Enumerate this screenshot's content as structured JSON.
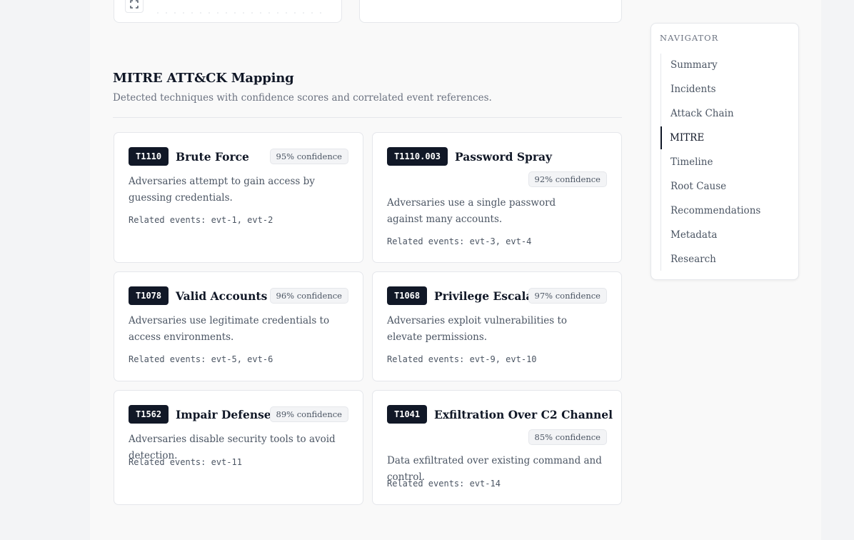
{
  "section": {
    "title": "MITRE ATT&CK Mapping",
    "description": "Detected techniques with confidence scores and correlated event references."
  },
  "techniques": [
    {
      "id": "T1110",
      "name": "Brute Force",
      "confidence": "95% confidence",
      "description": "Adversaries attempt to gain access by guessing credentials.",
      "related": "Related events: evt-1, evt-2"
    },
    {
      "id": "T1110.003",
      "name": "Password Spray",
      "confidence": "92% confidence",
      "description": "Adversaries use a single password against many accounts.",
      "related": "Related events: evt-3, evt-4"
    },
    {
      "id": "T1078",
      "name": "Valid Accounts",
      "confidence": "96% confidence",
      "description": "Adversaries use legitimate credentials to access environments.",
      "related": "Related events: evt-5, evt-6"
    },
    {
      "id": "T1068",
      "name": "Privilege Escalation",
      "confidence": "97% confidence",
      "description": "Adversaries exploit vulnerabilities to elevate permissions.",
      "related": "Related events: evt-9, evt-10"
    },
    {
      "id": "T1562",
      "name": "Impair Defenses",
      "confidence": "89% confidence",
      "description": "Adversaries disable security tools to avoid detection.",
      "related": "Related events: evt-11"
    },
    {
      "id": "T1041",
      "name": "Exfiltration Over C2 Channel",
      "confidence": "85% confidence",
      "description": "Data exfiltrated over existing command and control.",
      "related": "Related events: evt-14"
    }
  ],
  "navigator": {
    "title": "NAVIGATOR",
    "items": [
      "Summary",
      "Incidents",
      "Attack Chain",
      "MITRE",
      "Timeline",
      "Root Cause",
      "Recommendations",
      "Metadata",
      "Research"
    ],
    "active_item": "MITRE"
  },
  "icons": {
    "expand": "expand-icon"
  },
  "colors": {
    "badge_bg": "#111827",
    "accent": "#111827"
  }
}
